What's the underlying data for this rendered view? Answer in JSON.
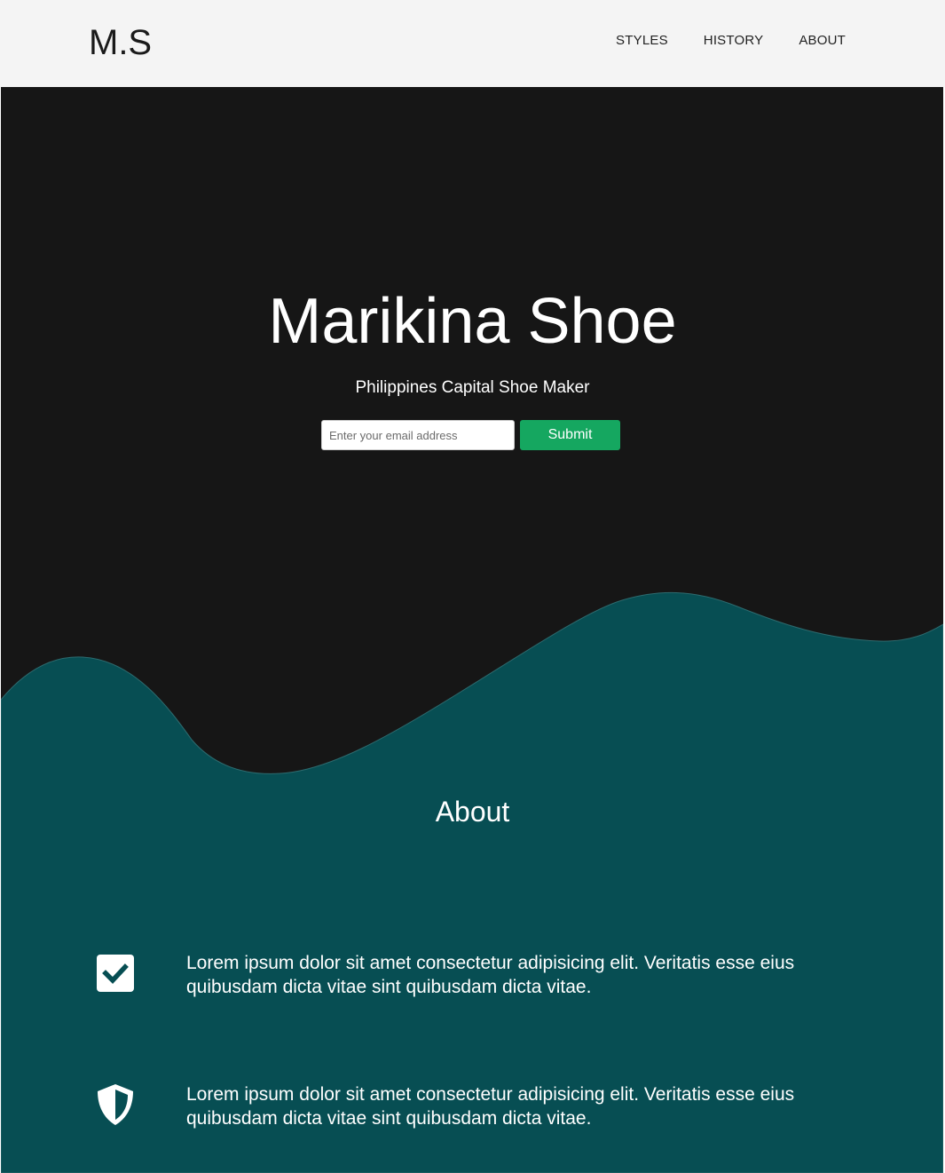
{
  "header": {
    "logo": "M.S",
    "nav": [
      {
        "label": "STYLES"
      },
      {
        "label": "HISTORY"
      },
      {
        "label": "ABOUT"
      }
    ]
  },
  "hero": {
    "title": "Marikina Shoe",
    "subtitle": "Philippines Capital Shoe Maker",
    "email_placeholder": "Enter your email address",
    "email_value": "",
    "submit_label": "Submit"
  },
  "about": {
    "title": "About",
    "features": [
      {
        "icon": "check-square-icon",
        "text": "Lorem ipsum dolor sit amet consectetur adipisicing elit. Veritatis esse eius quibusdam dicta vitae sint quibusdam dicta vitae."
      },
      {
        "icon": "shield-icon",
        "text": "Lorem ipsum dolor sit amet consectetur adipisicing elit. Veritatis esse eius quibusdam dicta vitae sint quibusdam dicta vitae."
      }
    ]
  },
  "colors": {
    "header_bg": "#f4f4f4",
    "hero_bg": "#161616",
    "teal": "#074e53",
    "accent_green": "#15a760"
  }
}
